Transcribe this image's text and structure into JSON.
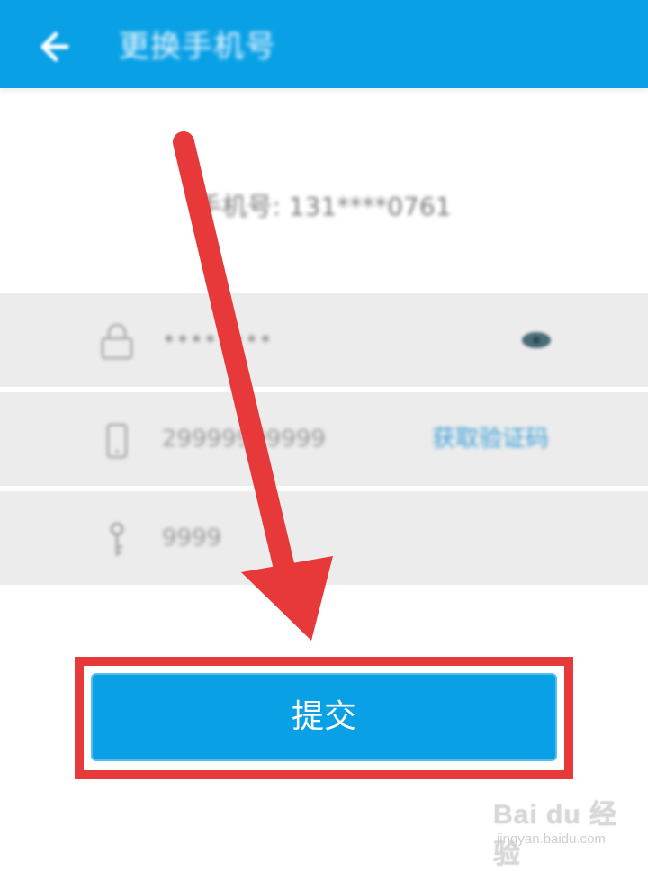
{
  "header": {
    "title": "更换手机号",
    "background": "#0aa0e6",
    "back_icon": "arrow-left-icon"
  },
  "current_phone": {
    "text": "手机号: 131****0761"
  },
  "form": {
    "password": {
      "icon": "lock-icon",
      "value": "••••••••",
      "toggle_icon": "eye-icon"
    },
    "new_phone": {
      "icon": "phone-icon",
      "value": "29999999999",
      "action_label": "获取验证码"
    },
    "code": {
      "icon": "key-icon",
      "value": "9999"
    }
  },
  "submit": {
    "label": "提交",
    "highlight_color": "#e8393a"
  },
  "watermark": {
    "brand": "Bai du 经验",
    "site": "jingyan.baidu.com"
  }
}
